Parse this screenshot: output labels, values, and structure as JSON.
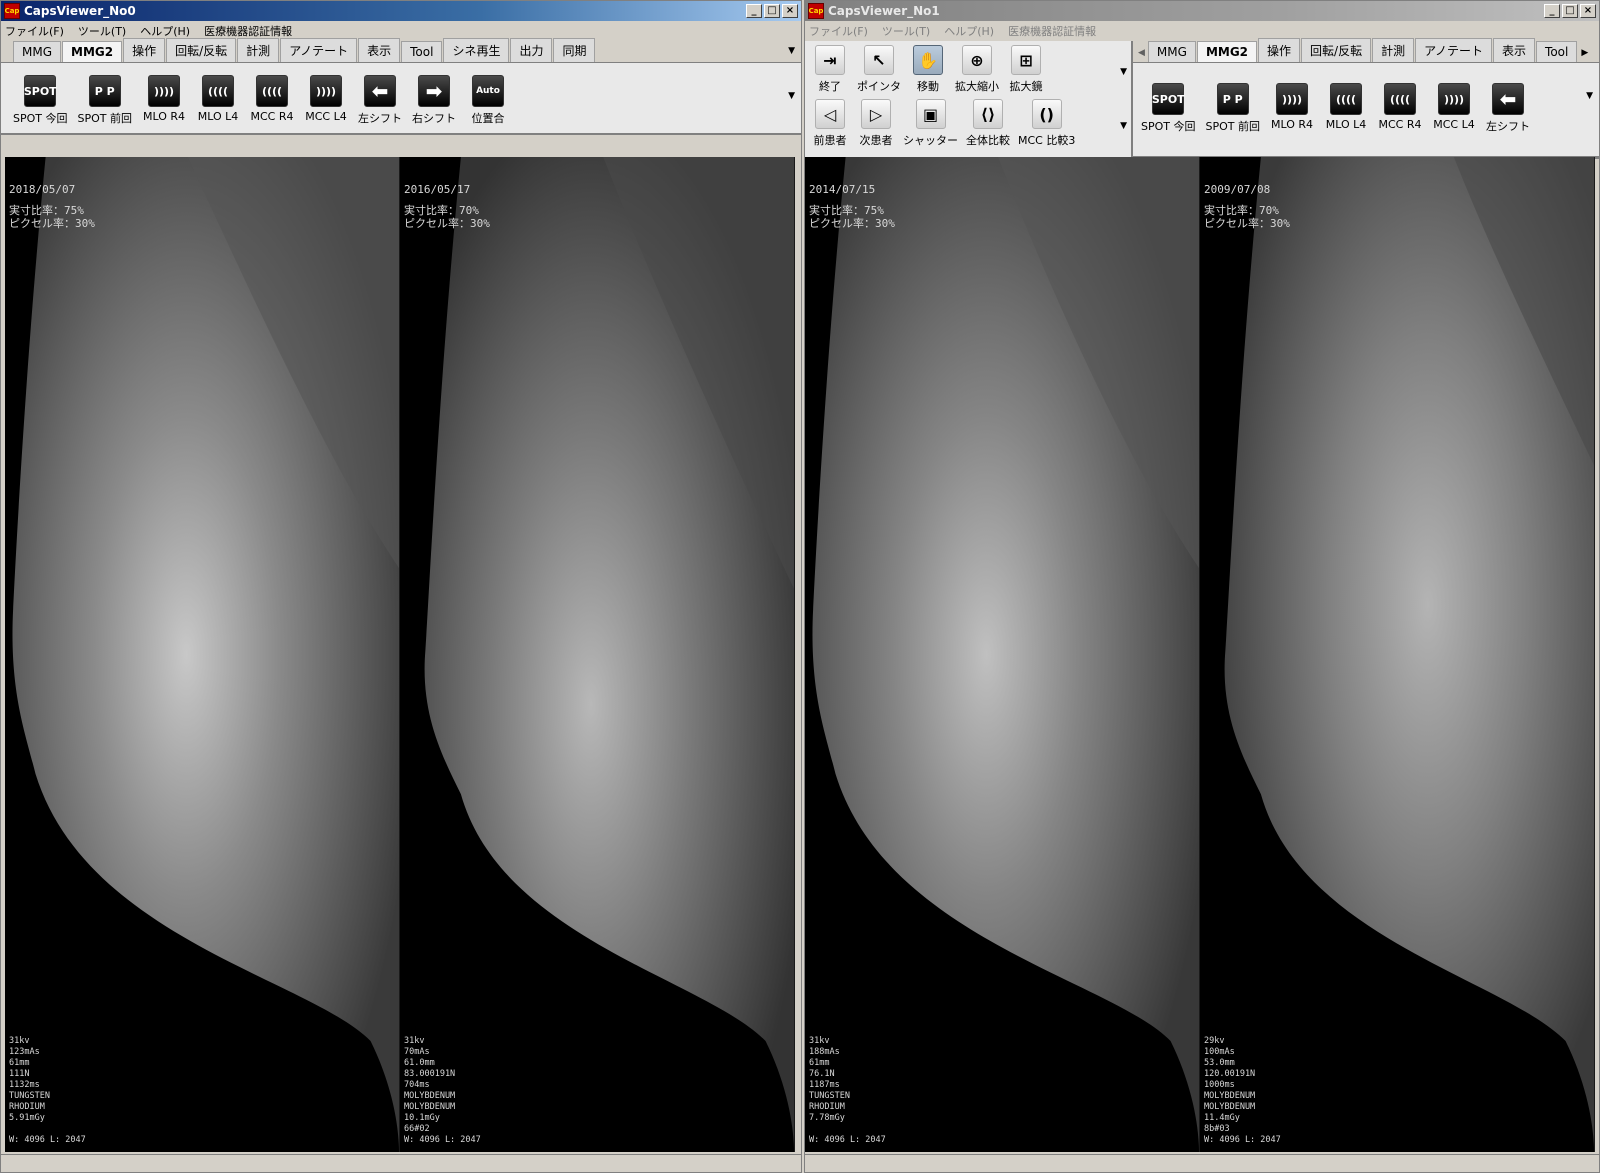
{
  "windows": [
    {
      "title": "CapsViewer_No0",
      "menu": [
        "ファイル(F)",
        "ツール(T)",
        "ヘルプ(H)",
        "医療機器認証情報"
      ],
      "tabs": [
        "MMG",
        "MMG2",
        "操作",
        "回転/反転",
        "計測",
        "アノテート",
        "表示",
        "Tool",
        "シネ再生",
        "出力",
        "同期"
      ],
      "active_tab": "MMG2",
      "tools": [
        "SPOT 今回",
        "SPOT 前回",
        "MLO R4",
        "MLO L4",
        "MCC R4",
        "MCC L4",
        "左シフト",
        "右シフト",
        "位置合"
      ],
      "panels": [
        {
          "date": "2018/05/07",
          "ratio": "実寸比率：75%",
          "pixel": "ピクセル率：30%",
          "params": [
            "31kv",
            "123mAs",
            "61mm",
            "111N",
            "1132ms",
            "TUNGSTEN",
            "RHODIUM",
            "5.91mGy"
          ],
          "wl": "W: 4096 L: 2047"
        },
        {
          "date": "2016/05/17",
          "ratio": "実寸比率：70%",
          "pixel": "ピクセル率：30%",
          "params": [
            "31kv",
            "70mAs",
            "61.0mm",
            "83.000191N",
            "704ms",
            "MOLYBDENUM",
            "MOLYBDENUM",
            "10.1mGy",
            " 66#02"
          ],
          "wl": "W: 4096 L: 2047"
        }
      ]
    },
    {
      "title": "CapsViewer_No1",
      "menu": [
        "ファイル(F)",
        "ツール(T)",
        "ヘルプ(H)",
        "医療機器認証情報"
      ],
      "tools_left_row1": [
        "終了",
        "ポインタ",
        "移動",
        "拡大縮小",
        "拡大鏡"
      ],
      "tools_left_row2": [
        "前患者",
        "次患者",
        "シャッター",
        "全体比較",
        "MCC 比較3"
      ],
      "tabs": [
        "MMG",
        "MMG2",
        "操作",
        "回転/反転",
        "計測",
        "アノテート",
        "表示",
        "Tool"
      ],
      "active_tab": "MMG2",
      "tools": [
        "SPOT 今回",
        "SPOT 前回",
        "MLO R4",
        "MLO L4",
        "MCC R4",
        "MCC L4",
        "左シフト"
      ],
      "panels": [
        {
          "date": "2014/07/15",
          "ratio": "実寸比率：75%",
          "pixel": "ピクセル率：30%",
          "params": [
            "31kv",
            "188mAs",
            "61mm",
            "76.1N",
            "1187ms",
            "TUNGSTEN",
            "RHODIUM",
            "7.78mGy"
          ],
          "wl": "W: 4096 L: 2047"
        },
        {
          "date": "2009/07/08",
          "ratio": "実寸比率：70%",
          "pixel": "ピクセル率：30%",
          "params": [
            "29kv",
            "100mAs",
            "53.0mm",
            "120.00191N",
            "1000ms",
            "MOLYBDENUM",
            "MOLYBDENUM",
            "11.4mGy",
            " 8b#03"
          ],
          "wl": "W: 4096 L: 2047"
        }
      ]
    }
  ],
  "icons": {
    "spot": "SPOT",
    "spot_p": "P P",
    "mlo": "MLO",
    "auto": "Auto"
  }
}
